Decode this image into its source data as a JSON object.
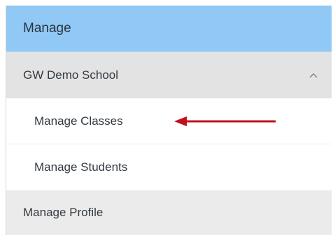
{
  "nav": {
    "header": {
      "title": "Manage"
    },
    "group": {
      "label": "GW Demo School",
      "expanded": true,
      "icon": "chevron-up-icon"
    },
    "subitems": [
      {
        "label": "Manage Classes"
      },
      {
        "label": "Manage Students"
      }
    ],
    "profile": {
      "label": "Manage Profile"
    }
  },
  "annotation": {
    "icon": "red-pointer-arrow-icon",
    "color": "#c0111f",
    "target": "Manage Classes"
  },
  "colors": {
    "header_bg": "#90c9f5",
    "group_bg": "#e3e3e3",
    "profile_bg": "#ebebeb"
  }
}
